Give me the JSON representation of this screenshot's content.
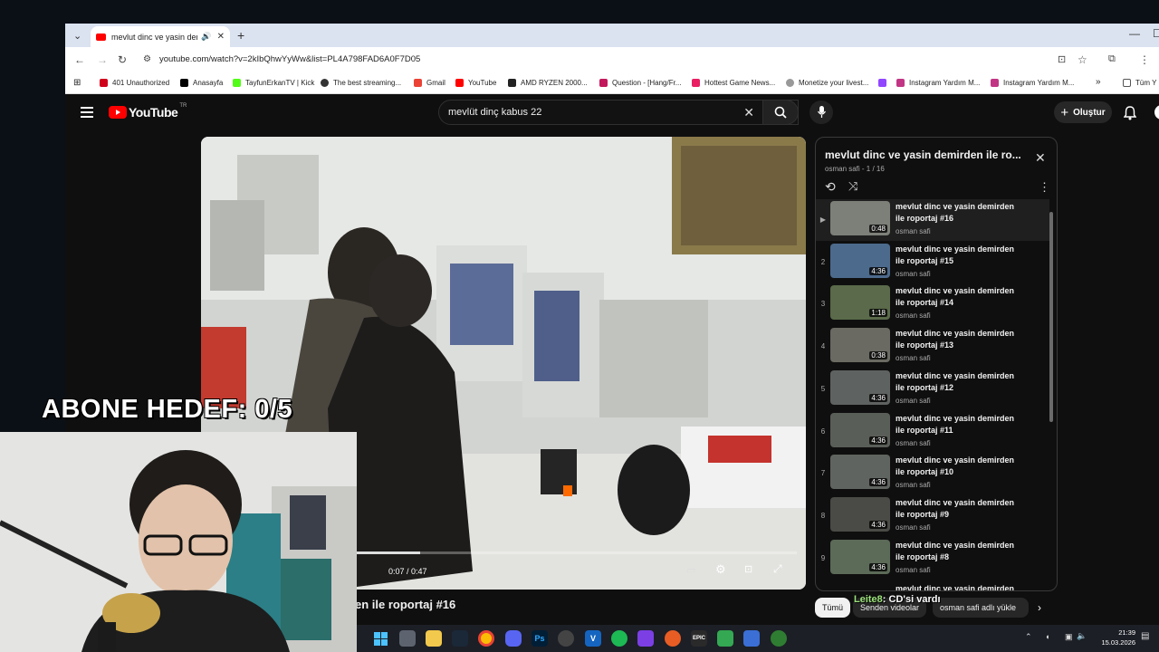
{
  "browser": {
    "tab_title": "mevlut dinc ve yasin demirden ile roportaj",
    "url": "youtube.com/watch?v=2kIbQhwYyWw&list=PL4A798FAD6A0F7D05",
    "bookmarks": [
      {
        "label": "401 Unauthorized",
        "icon": "huawei-icon",
        "color": "#d0021b"
      },
      {
        "label": "Anasayfa",
        "icon": "x-icon",
        "color": "#000000"
      },
      {
        "label": "TayfunErkanTV | Kick",
        "icon": "kick-icon",
        "color": "#53fc18"
      },
      {
        "label": "The best streaming...",
        "icon": "obs-icon",
        "color": "#333333"
      },
      {
        "label": "Gmail",
        "icon": "gmail-icon",
        "color": "#ea4335"
      },
      {
        "label": "YouTube",
        "icon": "youtube-icon",
        "color": "#ff0000"
      },
      {
        "label": "AMD RYZEN 2000...",
        "icon": "amd-icon",
        "color": "#222222"
      },
      {
        "label": "Question - [Hang/Fr...",
        "icon": "t-icon",
        "color": "#c2185b"
      },
      {
        "label": "Hottest Game News...",
        "icon": "flag-icon",
        "color": "#e91e63"
      },
      {
        "label": "Monetize your livest...",
        "icon": "sun-icon",
        "color": "#999999"
      },
      {
        "label": "",
        "icon": "twitch-icon",
        "color": "#9146ff"
      },
      {
        "label": "Instagram Yardım M...",
        "icon": "instagram-icon",
        "color": "#c13584"
      },
      {
        "label": "Instagram Yardım M...",
        "icon": "instagram-icon",
        "color": "#c13584"
      }
    ],
    "all_bookmarks": "Tüm Y"
  },
  "youtube": {
    "logo_text": "YouTube",
    "region": "TR",
    "search_value": "mevlüt dinç kabus 22",
    "create_label": "Oluştur",
    "player": {
      "time": "0:07 / 0:47",
      "progress": 0.15
    },
    "video_title": "en ile roportaj #16",
    "playlist": {
      "title": "mevlut dinc ve yasin demirden ile ro...",
      "subtitle": "osman safi - 1 / 16",
      "items": [
        {
          "index": "▶",
          "title": "mevlut dinc ve yasin demirden ile roportaj #16",
          "channel": "osman safi",
          "duration": "0:48"
        },
        {
          "index": "2",
          "title": "mevlut dinc ve yasin demirden ile roportaj #15",
          "channel": "osman safi",
          "duration": "4:36"
        },
        {
          "index": "3",
          "title": "mevlut dinc ve yasin demirden ile roportaj #14",
          "channel": "osman safi",
          "duration": "1:18"
        },
        {
          "index": "4",
          "title": "mevlut dinc ve yasin demirden ile roportaj #13",
          "channel": "osman safi",
          "duration": "0:38"
        },
        {
          "index": "5",
          "title": "mevlut dinc ve yasin demirden ile roportaj #12",
          "channel": "osman safi",
          "duration": "4:36"
        },
        {
          "index": "6",
          "title": "mevlut dinc ve yasin demirden ile roportaj #11",
          "channel": "osman safi",
          "duration": "4:36"
        },
        {
          "index": "7",
          "title": "mevlut dinc ve yasin demirden ile roportaj #10",
          "channel": "osman safi",
          "duration": "4:36"
        },
        {
          "index": "8",
          "title": "mevlut dinc ve yasin demirden ile roportaj #9",
          "channel": "osman safi",
          "duration": "4:36"
        },
        {
          "index": "9",
          "title": "mevlut dinc ve yasin demirden ile roportaj #8",
          "channel": "osman safi",
          "duration": "4:36"
        }
      ],
      "partial_next_title": "mevlut dinc ve yasin demirden"
    },
    "chips": [
      "Tümü",
      "Senden videolar",
      "osman safi adlı yükle"
    ]
  },
  "overlay": {
    "goal_text": "ABONE HEDEF:  0/5",
    "chat_user": "Leite8",
    "chat_message": ": CD'si vardı"
  },
  "taskbar": {
    "time": "21:39",
    "date": "15.03.2026"
  }
}
